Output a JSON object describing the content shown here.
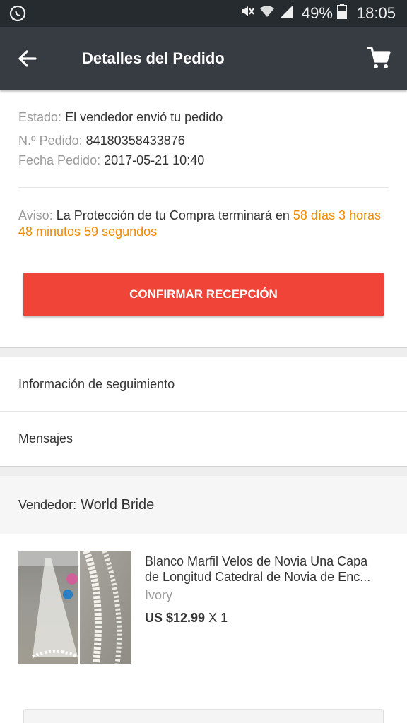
{
  "status_bar": {
    "battery": "49%",
    "time": "18:05",
    "icons": [
      "whatsapp-icon",
      "mute-icon",
      "wifi-icon",
      "signal-icon",
      "battery-icon"
    ]
  },
  "header": {
    "title": "Detalles del Pedido",
    "icons": [
      "back-arrow-icon",
      "cart-icon"
    ]
  },
  "order": {
    "status_label": "Estado:",
    "status_value": "El vendedor envió tu pedido",
    "number_label": "N.º Pedido:",
    "number_value": "84180358433876",
    "date_label": "Fecha Pedido:",
    "date_value": "2017-05-21 10:40"
  },
  "notice": {
    "label": "Aviso:",
    "text": "La Protección de tu Compra terminará en",
    "countdown": "58 días 3 horas 48 minutos 59 segundos"
  },
  "confirm_button": "CONFIRMAR RECEPCIÓN",
  "links": {
    "tracking": "Información de seguimiento",
    "messages": "Mensajes"
  },
  "seller": {
    "label": "Vendedor:",
    "name": "World Bride"
  },
  "product": {
    "title": "Blanco Marfil Velos de Novia Una Capa de Longitud Catedral de Novia de Enc...",
    "variant": "Ivory",
    "price": "US $12.99",
    "quantity": "X 1"
  },
  "colors": {
    "accent": "#f04438",
    "countdown": "#f08a00",
    "app_bar": "#373c42",
    "status_bar": "#262b30"
  }
}
